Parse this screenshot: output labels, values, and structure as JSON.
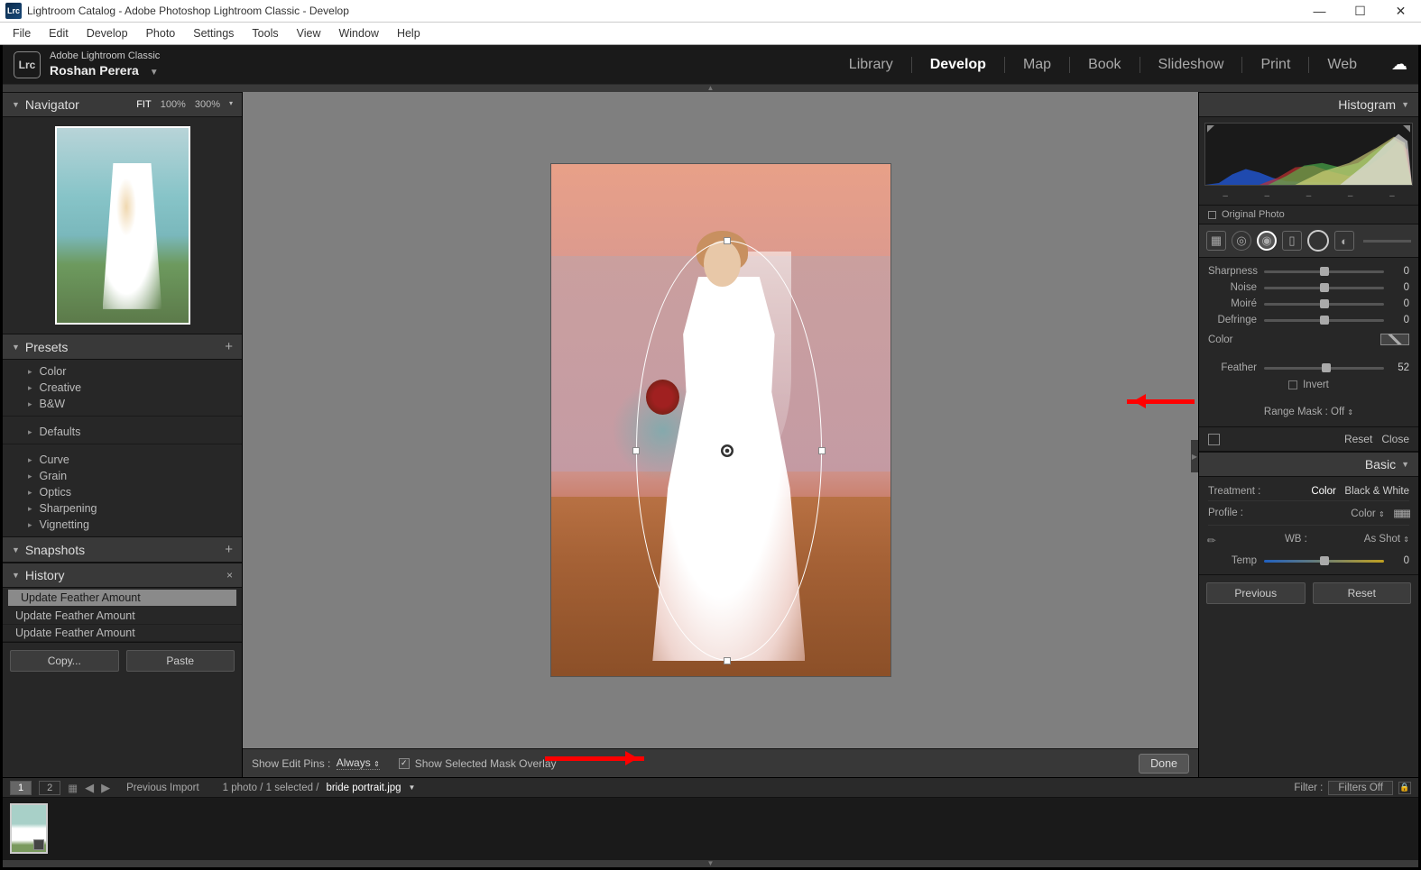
{
  "window": {
    "title": "Lightroom Catalog - Adobe Photoshop Lightroom Classic - Develop",
    "app_abbr": "Lrc"
  },
  "menu": [
    "File",
    "Edit",
    "Develop",
    "Photo",
    "Settings",
    "Tools",
    "View",
    "Window",
    "Help"
  ],
  "identity": {
    "product": "Adobe Lightroom Classic",
    "user": "Roshan Perera"
  },
  "modules": {
    "items": [
      "Library",
      "Develop",
      "Map",
      "Book",
      "Slideshow",
      "Print",
      "Web"
    ],
    "active": "Develop"
  },
  "navigator": {
    "title": "Navigator",
    "zoom": [
      "FIT",
      "100%",
      "300%"
    ]
  },
  "presets": {
    "title": "Presets",
    "groups1": [
      "Color",
      "Creative",
      "B&W"
    ],
    "groups2": [
      "Defaults"
    ],
    "groups3": [
      "Curve",
      "Grain",
      "Optics",
      "Sharpening",
      "Vignetting"
    ]
  },
  "snapshots": {
    "title": "Snapshots"
  },
  "history": {
    "title": "History",
    "items": [
      "Update Feather Amount",
      "Update Feather Amount",
      "Update Feather Amount"
    ]
  },
  "left_buttons": {
    "copy": "Copy...",
    "paste": "Paste"
  },
  "toolbar": {
    "show_pins_label": "Show Edit Pins :",
    "show_pins_value": "Always",
    "mask_overlay": "Show Selected Mask Overlay",
    "done": "Done"
  },
  "right": {
    "histogram": "Histogram",
    "original": "Original Photo",
    "sliders": [
      {
        "label": "Sharpness",
        "value": "0",
        "pos": 50
      },
      {
        "label": "Noise",
        "value": "0",
        "pos": 50
      },
      {
        "label": "Moiré",
        "value": "0",
        "pos": 50
      },
      {
        "label": "Defringe",
        "value": "0",
        "pos": 50
      }
    ],
    "color_label": "Color",
    "feather": {
      "label": "Feather",
      "value": "52",
      "pos": 52
    },
    "invert": "Invert",
    "range_mask": "Range Mask :",
    "range_mask_val": "Off",
    "reset": "Reset",
    "close": "Close",
    "basic": {
      "title": "Basic",
      "treatment_label": "Treatment :",
      "treatment_color": "Color",
      "treatment_bw": "Black & White",
      "profile_label": "Profile :",
      "profile_value": "Color",
      "wb_label": "WB :",
      "wb_value": "As Shot",
      "temp_label": "Temp",
      "temp_value": "0"
    },
    "buttons": {
      "prev": "Previous",
      "reset": "Reset"
    }
  },
  "filmstrip": {
    "views": [
      "1",
      "2"
    ],
    "source": "Previous Import",
    "count": "1 photo / 1 selected /",
    "filename": "bride portrait.jpg",
    "filter_label": "Filter :",
    "filters_off": "Filters Off"
  }
}
